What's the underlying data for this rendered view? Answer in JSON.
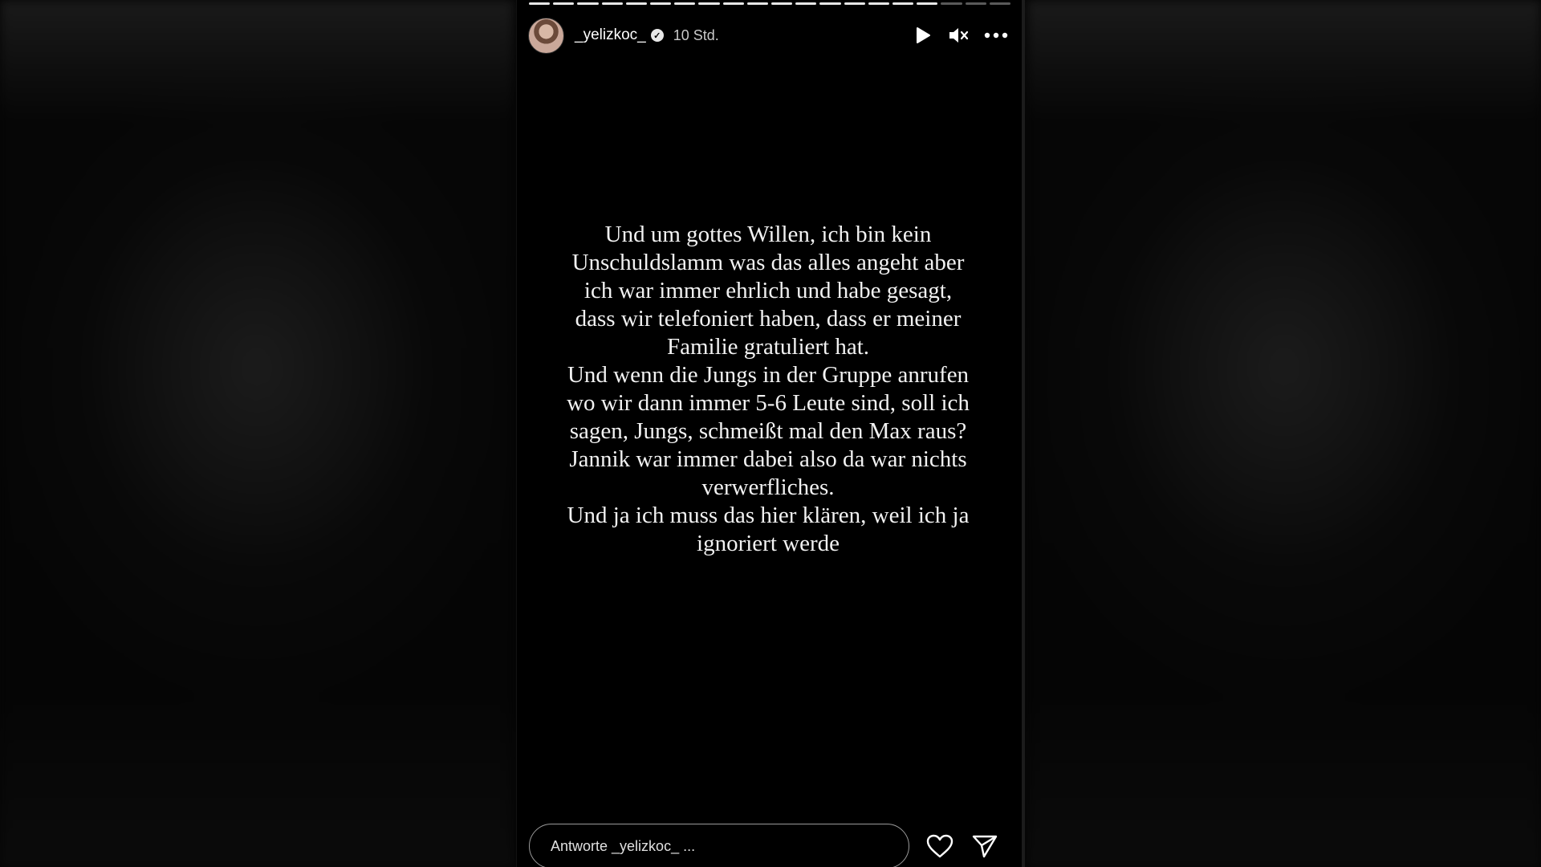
{
  "story": {
    "progress": {
      "segments": 20,
      "completed": 17
    },
    "header": {
      "username": "_yelizkoc_",
      "verified": true,
      "timestamp": "10 Std."
    },
    "controls": {
      "play_icon": "play-icon",
      "mute_icon": "mute-icon",
      "more_icon": "more-options-icon"
    },
    "text_lines": [
      "Und um gottes Willen, ich bin kein",
      "Unschuldslamm was das alles angeht aber",
      "ich war immer ehrlich und habe gesagt,",
      "dass wir telefoniert haben, dass er meiner",
      "Familie gratuliert hat.",
      "Und wenn die Jungs in der Gruppe anrufen",
      "wo wir dann immer 5-6 Leute sind, soll ich",
      "sagen, Jungs, schmeißt mal den Max raus?",
      "Jannik war immer dabei also da war nichts",
      "verwerfliches.",
      "Und ja ich muss das hier klären, weil ich ja",
      "ignoriert werde"
    ],
    "footer": {
      "reply_placeholder": "Antworte _yelizkoc_ ...",
      "like_icon": "heart-icon",
      "share_icon": "send-icon"
    }
  },
  "colors": {
    "background": "#000000",
    "text": "#f2f2f2",
    "progress_done": "#e6e6e6"
  }
}
